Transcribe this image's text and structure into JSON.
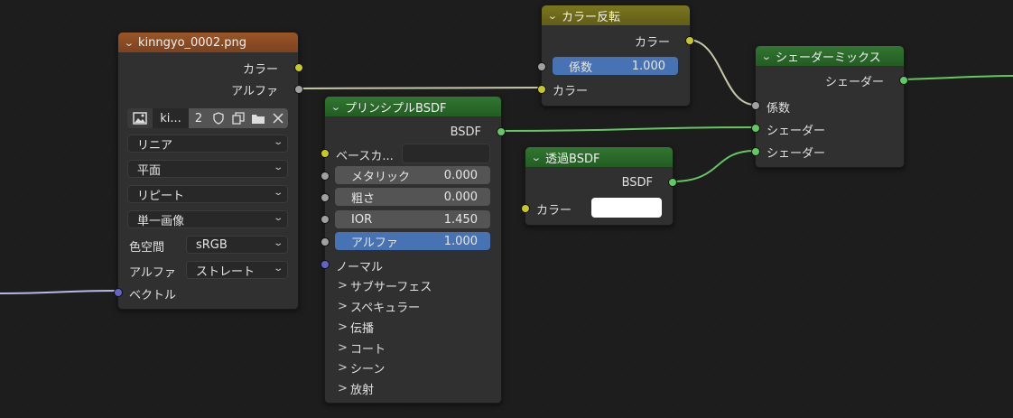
{
  "colors": {
    "background": "#1d1d1d",
    "node_body": "#303030",
    "texture_header": "#8a4a22",
    "color_header": "#6d6a1c",
    "shader_header": "#2a6a2a",
    "socket_yellow": "#c7c729",
    "socket_gray": "#a1a1a1",
    "socket_green": "#63c763",
    "socket_blue": "#6363c7",
    "field_blue": "#4772b3"
  },
  "image_node": {
    "title": "kinngyo_0002.png",
    "outputs": [
      "カラー",
      "アルファ"
    ],
    "image_name": "ki...",
    "user_count": "2",
    "interpolation": "リニア",
    "projection": "平面",
    "extension": "リピート",
    "source": "単一画像",
    "colorspace_label": "色空間",
    "colorspace_value": "sRGB",
    "alpha_label": "アルファ",
    "alpha_value": "ストレート",
    "input_vector": "ベクトル"
  },
  "principled_node": {
    "title": "プリンシプルBSDF",
    "output": "BSDF",
    "base_color_label": "ベースカ...",
    "fields": [
      {
        "label": "メタリック",
        "value": "0.000"
      },
      {
        "label": "粗さ",
        "value": "0.000"
      },
      {
        "label": "IOR",
        "value": "1.450"
      },
      {
        "label": "アルファ",
        "value": "1.000"
      }
    ],
    "normal_label": "ノーマル",
    "panels": [
      "サブサーフェス",
      "スペキュラー",
      "伝播",
      "コート",
      "シーン",
      "放射"
    ]
  },
  "invert_node": {
    "title": "カラー反転",
    "output": "カラー",
    "factor_label": "係数",
    "factor_value": "1.000",
    "input_color": "カラー"
  },
  "transparent_node": {
    "title": "透過BSDF",
    "output": "BSDF",
    "input_color": "カラー"
  },
  "mix_node": {
    "title": "シェーダーミックス",
    "output": "シェーダー",
    "factor_label": "係数",
    "shader1": "シェーダー",
    "shader2": "シェーダー"
  }
}
